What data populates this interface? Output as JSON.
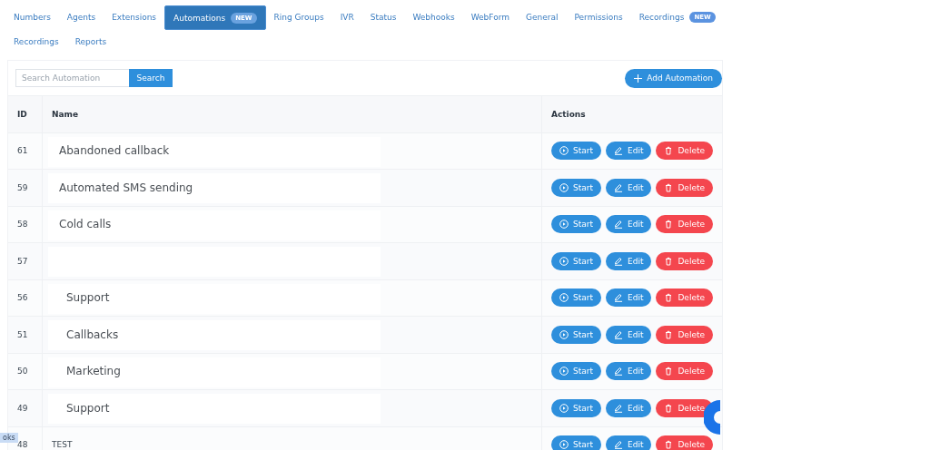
{
  "tabs": [
    {
      "label": "Numbers",
      "selected": false
    },
    {
      "label": "Agents",
      "selected": false
    },
    {
      "label": "Extensions",
      "selected": false
    },
    {
      "label": "Automations",
      "selected": true,
      "badge": "NEW"
    },
    {
      "label": "Ring Groups",
      "selected": false
    },
    {
      "label": "IVR",
      "selected": false
    },
    {
      "label": "Status",
      "selected": false
    },
    {
      "label": "Webhooks",
      "selected": false
    },
    {
      "label": "WebForm",
      "selected": false
    },
    {
      "label": "General",
      "selected": false
    },
    {
      "label": "Permissions",
      "selected": false
    },
    {
      "label": "Recordings",
      "selected": false,
      "badge": "NEW"
    },
    {
      "label": "Recordings",
      "selected": false
    },
    {
      "label": "Reports",
      "selected": false
    }
  ],
  "search": {
    "placeholder": "Search Automation",
    "button": "Search"
  },
  "add_button": "Add Automation",
  "table": {
    "columns": [
      "ID",
      "Name",
      "Actions"
    ],
    "rows": [
      {
        "id": "61",
        "name": "Abandoned callback",
        "kind": "overlay",
        "actions": [
          "Start",
          "Edit",
          "Delete"
        ]
      },
      {
        "id": "59",
        "name": "Automated SMS sending",
        "kind": "overlay",
        "actions": [
          "Start",
          "Edit",
          "Delete"
        ]
      },
      {
        "id": "58",
        "name": "Cold calls",
        "kind": "overlay",
        "actions": [
          "Start",
          "Edit",
          "Delete"
        ]
      },
      {
        "id": "57",
        "kind": "overlay",
        "actions": [
          "Start",
          "Edit",
          "Delete"
        ]
      },
      {
        "id": "56",
        "name": "Support",
        "kind": "overlay-indented",
        "actions": [
          "Start",
          "Edit",
          "Delete"
        ]
      },
      {
        "id": "51",
        "name": "Callbacks",
        "kind": "overlay-indented",
        "actions": [
          "Start",
          "Edit",
          "Delete"
        ]
      },
      {
        "id": "50",
        "name": "Marketing",
        "kind": "overlay-indented",
        "actions": [
          "Start",
          "Edit",
          "Delete"
        ]
      },
      {
        "id": "49",
        "name": "Support",
        "kind": "overlay-indented",
        "actions": [
          "Start",
          "Edit",
          "Delete"
        ]
      },
      {
        "id": "48",
        "name": "TEST",
        "kind": "plain",
        "actions": [
          "Start",
          "Edit",
          "Delete"
        ]
      }
    ]
  },
  "tooltip": "oks"
}
